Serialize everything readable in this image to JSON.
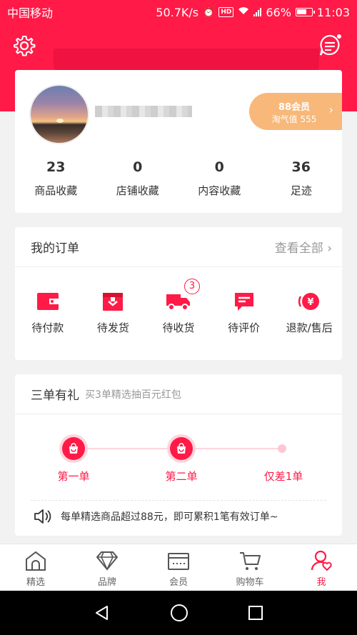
{
  "status_bar": {
    "carrier": "中国移动",
    "speed": "50.7K/s",
    "battery": "66%",
    "time": "11:03",
    "battery_level": 0.66
  },
  "profile": {
    "member": {
      "title": "88会员",
      "score": "淘气值 555"
    },
    "stats": [
      {
        "num": "23",
        "label": "商品收藏"
      },
      {
        "num": "0",
        "label": "店铺收藏"
      },
      {
        "num": "0",
        "label": "内容收藏"
      },
      {
        "num": "36",
        "label": "足迹"
      }
    ]
  },
  "orders": {
    "title": "我的订单",
    "view_all": "查看全部",
    "items": [
      {
        "label": "待付款",
        "icon": "wallet-icon"
      },
      {
        "label": "待发货",
        "icon": "package-icon"
      },
      {
        "label": "待收货",
        "icon": "truck-icon",
        "badge": "3"
      },
      {
        "label": "待评价",
        "icon": "comment-icon"
      },
      {
        "label": "退款/售后",
        "icon": "refund-icon"
      }
    ]
  },
  "promo": {
    "title": "三单有礼",
    "subtitle": "买3单精选抽百元红包",
    "steps": [
      "第一单",
      "第二单",
      "仅差1单"
    ],
    "note": "每单精选商品超过88元，即可累积1笔有效订单~"
  },
  "tabs": [
    {
      "label": "精选",
      "icon": "home-icon"
    },
    {
      "label": "品牌",
      "icon": "diamond-icon"
    },
    {
      "label": "会员",
      "icon": "member-card-icon"
    },
    {
      "label": "购物车",
      "icon": "cart-icon"
    },
    {
      "label": "我",
      "icon": "user-icon",
      "active": true
    }
  ],
  "colors": {
    "accent": "#ff1a47",
    "member_pill": "#f7b87a"
  }
}
